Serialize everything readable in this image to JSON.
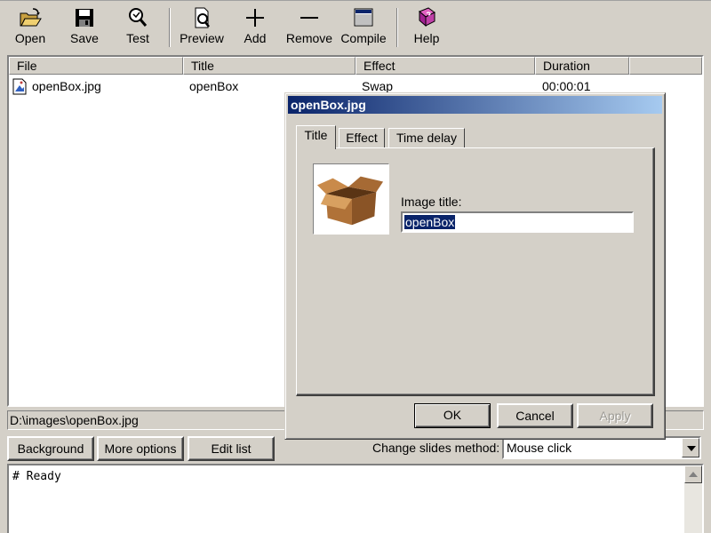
{
  "toolbar": {
    "buttons": [
      {
        "label": "Open",
        "icon": "folder-open-icon"
      },
      {
        "label": "Save",
        "icon": "floppy-disk-icon"
      },
      {
        "label": "Test",
        "icon": "magnifier-test-icon"
      },
      {
        "label": "Preview",
        "icon": "preview-page-icon"
      },
      {
        "label": "Add",
        "icon": "plus-icon"
      },
      {
        "label": "Remove",
        "icon": "minus-icon"
      },
      {
        "label": "Compile",
        "icon": "window-compile-icon"
      },
      {
        "label": "Help",
        "icon": "help-book-icon"
      }
    ]
  },
  "list": {
    "columns": [
      "File",
      "Title",
      "Effect",
      "Duration"
    ],
    "rows": [
      {
        "file": "openBox.jpg",
        "title": "openBox",
        "effect": "Swap",
        "duration": "00:00:01"
      }
    ]
  },
  "path": "D:\\images\\openBox.jpg",
  "bottom": {
    "background_label": "Background",
    "more_options_label": "More options",
    "edit_list_label": "Edit list",
    "change_slides_label": "Change slides method:",
    "change_slides_value": "Mouse click"
  },
  "log": {
    "text": "# Ready"
  },
  "dialog": {
    "title": "openBox.jpg",
    "tabs": [
      "Title",
      "Effect",
      "Time delay"
    ],
    "active_tab": "Title",
    "image_title_label": "Image title:",
    "image_title_value": "openBox",
    "ok_label": "OK",
    "cancel_label": "Cancel",
    "apply_label": "Apply"
  },
  "colors": {
    "titlebar_start": "#0a246a",
    "titlebar_end": "#a6caf0",
    "window_face": "#d4d0c8",
    "selection": "#0a246a"
  }
}
